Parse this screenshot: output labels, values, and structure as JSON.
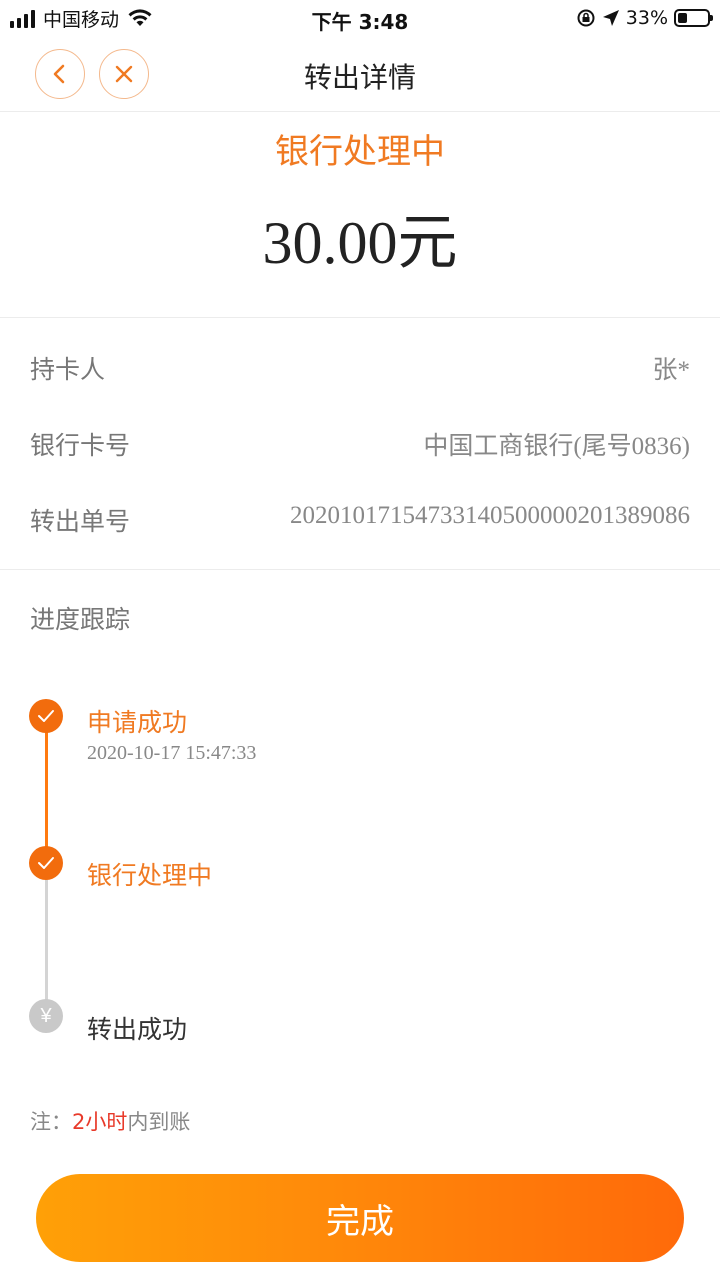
{
  "status_bar": {
    "carrier": "中国移动",
    "time": "下午 3:48",
    "battery_percent": "33%",
    "battery_level": 0.33
  },
  "nav": {
    "title": "转出详情",
    "back_icon": "chevron-left-icon",
    "close_icon": "close-icon",
    "accent": "#f07a22"
  },
  "summary": {
    "status": "银行处理中",
    "amount": "30.00元"
  },
  "details": [
    {
      "label": "持卡人",
      "value": "张*"
    },
    {
      "label": "银行卡号",
      "value": "中国工商银行(尾号0836)"
    },
    {
      "label": "转出单号",
      "value": "20201017154733140500000201389086"
    }
  ],
  "progress": {
    "title": "进度跟踪",
    "steps": [
      {
        "label": "申请成功",
        "time": "2020-10-17 15:47:33",
        "state": "done"
      },
      {
        "label": "银行处理中",
        "state": "done"
      },
      {
        "label": "转出成功",
        "state": "pending",
        "icon_text": "¥"
      }
    ]
  },
  "note": {
    "prefix": "注：",
    "highlight": "2小时",
    "suffix": "内到账"
  },
  "done_button": "完成"
}
